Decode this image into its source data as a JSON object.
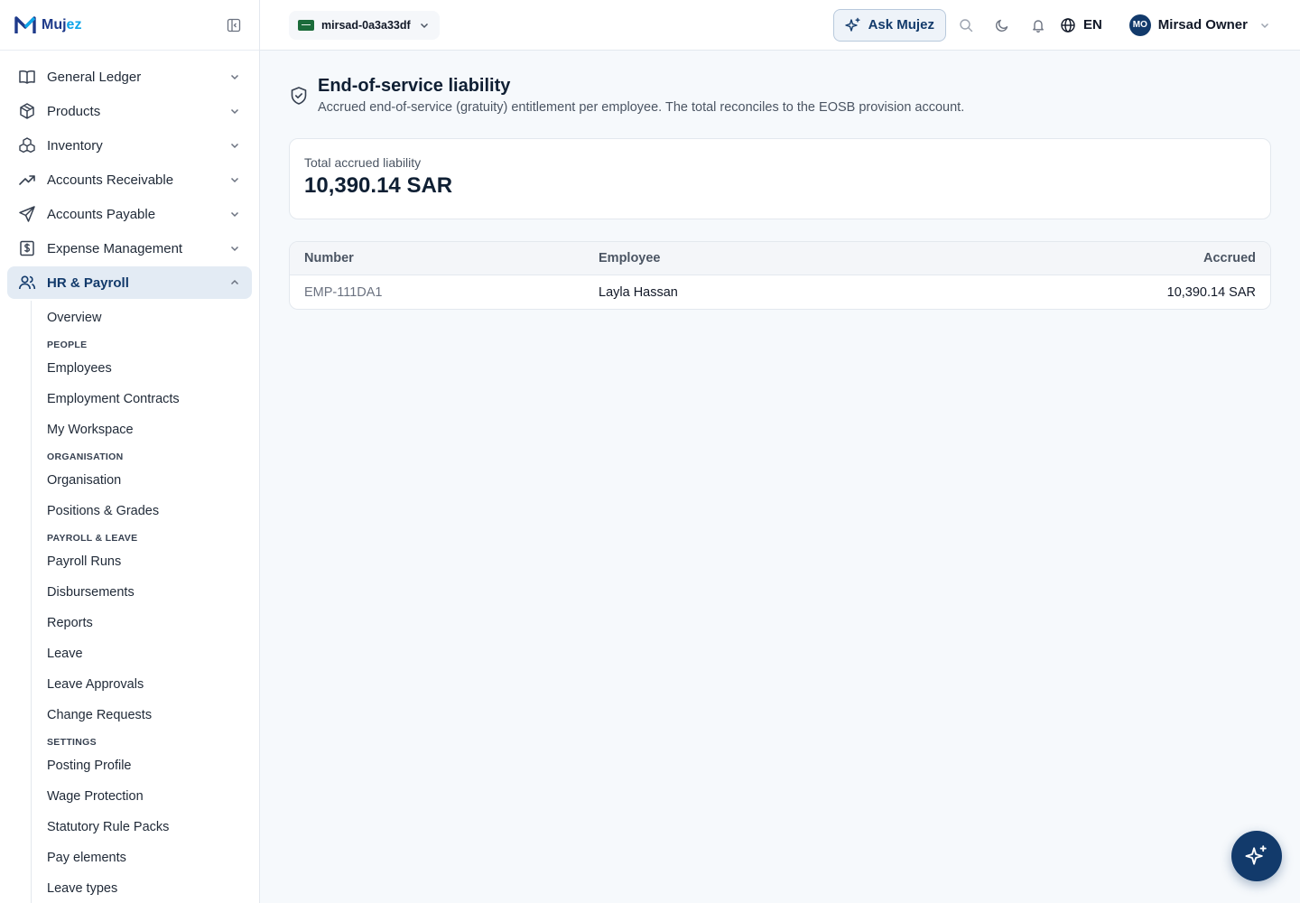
{
  "brand": {
    "name_a": "Muj",
    "name_b": "ez"
  },
  "org_switcher": {
    "label": "mirsad-0a3a33df"
  },
  "topbar": {
    "ask_label": "Ask Mujez",
    "lang": "EN",
    "avatar_initials": "MO",
    "user_name": "Mirsad Owner"
  },
  "sidebar": {
    "items": [
      {
        "label": "General Ledger",
        "icon": "book-open-icon"
      },
      {
        "label": "Products",
        "icon": "package-icon"
      },
      {
        "label": "Inventory",
        "icon": "boxes-icon"
      },
      {
        "label": "Accounts Receivable",
        "icon": "trending-up-icon"
      },
      {
        "label": "Accounts Payable",
        "icon": "send-icon"
      },
      {
        "label": "Expense Management",
        "icon": "receipt-icon"
      },
      {
        "label": "HR & Payroll",
        "icon": "users-icon",
        "active": true
      }
    ],
    "hr_sub": {
      "overview": "Overview",
      "sec_people": "PEOPLE",
      "employees": "Employees",
      "contracts": "Employment Contracts",
      "workspace": "My Workspace",
      "sec_org": "ORGANISATION",
      "organisation": "Organisation",
      "positions": "Positions & Grades",
      "sec_payroll": "PAYROLL & LEAVE",
      "payroll_runs": "Payroll Runs",
      "disbursements": "Disbursements",
      "reports": "Reports",
      "leave": "Leave",
      "leave_approvals": "Leave Approvals",
      "change_requests": "Change Requests",
      "sec_settings": "SETTINGS",
      "posting_profile": "Posting Profile",
      "wage_protection": "Wage Protection",
      "rule_packs": "Statutory Rule Packs",
      "pay_elements": "Pay elements",
      "leave_types": "Leave types"
    }
  },
  "page": {
    "title": "End-of-service liability",
    "subtitle": "Accrued end-of-service (gratuity) entitlement per employee. The total reconciles to the EOSB provision account.",
    "total_label": "Total accrued liability",
    "total_value": "10,390.14 SAR"
  },
  "table": {
    "headers": {
      "number": "Number",
      "employee": "Employee",
      "accrued": "Accrued"
    },
    "rows": [
      {
        "number": "EMP-111DA1",
        "employee": "Layla Hassan",
        "accrued": "10,390.14 SAR"
      }
    ]
  },
  "colors": {
    "primary": "#123a6b",
    "active_bg": "#e3ebf4",
    "page_bg": "#f6f9fc"
  }
}
